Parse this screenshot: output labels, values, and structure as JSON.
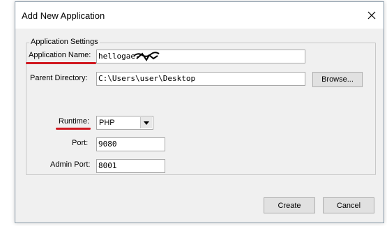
{
  "dialog": {
    "title": "Add New Application"
  },
  "group": {
    "legend": "Application Settings"
  },
  "fields": {
    "app_name_label": "Application Name:",
    "app_name_value": "hellogae-",
    "parent_dir_label": "Parent Directory:",
    "parent_dir_value": "C:\\Users\\user\\Desktop",
    "runtime_label": "Runtime:",
    "runtime_value": "PHP",
    "port_label": "Port:",
    "port_value": "9080",
    "admin_port_label": "Admin Port:",
    "admin_port_value": "8001"
  },
  "buttons": {
    "browse": "Browse...",
    "create": "Create",
    "cancel": "Cancel"
  },
  "annotation_color": "#d01820",
  "icons": {
    "close": "close-icon",
    "dropdown": "chevron-down-icon"
  }
}
